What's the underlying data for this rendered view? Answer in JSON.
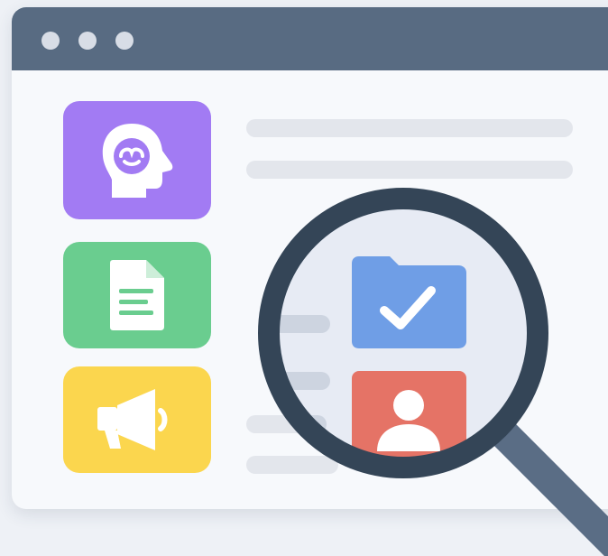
{
  "window": {
    "titlebar_color": "#586b82",
    "controls": [
      "window-dot",
      "window-dot",
      "window-dot"
    ]
  },
  "sidebar": {
    "tiles": [
      {
        "icon": "brain-head-icon",
        "color": "#a27bf3"
      },
      {
        "icon": "document-icon",
        "color": "#6acd8f"
      },
      {
        "icon": "megaphone-icon",
        "color": "#fbd64e"
      }
    ]
  },
  "magnifier": {
    "icons": [
      {
        "icon": "folder-check-icon",
        "color": "#6f9ee6"
      },
      {
        "icon": "user-icon",
        "color": "#e57366"
      }
    ],
    "ring_color": "#344557",
    "handle_color": "#5a6d85"
  }
}
